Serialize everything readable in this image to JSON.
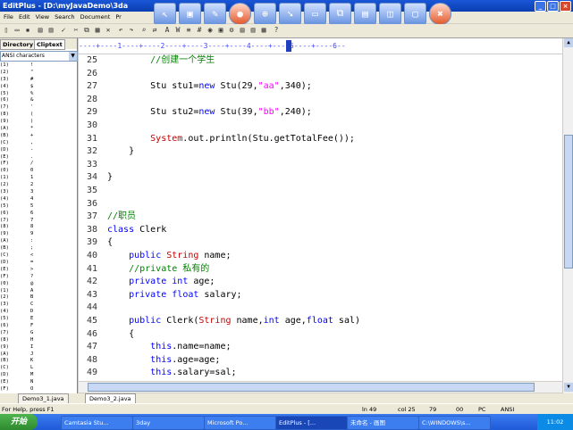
{
  "window": {
    "title": "EditPlus - [D:\\myJavaDemo\\3da"
  },
  "menu": [
    "File",
    "Edit",
    "View",
    "Search",
    "Document",
    "Pr"
  ],
  "panel": {
    "tab_directory": "Directory",
    "tab_cliptext": "Cliptext",
    "charset": "ANSI characters"
  },
  "charlist": [
    [
      "(1)",
      "!"
    ],
    [
      "(2)",
      "\""
    ],
    [
      "(3)",
      "#"
    ],
    [
      "(4)",
      "$"
    ],
    [
      "(5)",
      "%"
    ],
    [
      "(6)",
      "&"
    ],
    [
      "(7)",
      "'"
    ],
    [
      "(8)",
      "("
    ],
    [
      "(9)",
      ")"
    ],
    [
      "(A)",
      "*"
    ],
    [
      "(B)",
      "+"
    ],
    [
      "(C)",
      ","
    ],
    [
      "(D)",
      "-"
    ],
    [
      "(E)",
      "."
    ],
    [
      "(F)",
      "/"
    ],
    [
      "(0)",
      "0"
    ],
    [
      "(1)",
      "1"
    ],
    [
      "(2)",
      "2"
    ],
    [
      "(3)",
      "3"
    ],
    [
      "(4)",
      "4"
    ],
    [
      "(5)",
      "5"
    ],
    [
      "(6)",
      "6"
    ],
    [
      "(7)",
      "7"
    ],
    [
      "(8)",
      "8"
    ],
    [
      "(9)",
      "9"
    ],
    [
      "(A)",
      ":"
    ],
    [
      "(B)",
      ";"
    ],
    [
      "(C)",
      "<"
    ],
    [
      "(D)",
      "="
    ],
    [
      "(E)",
      ">"
    ],
    [
      "(F)",
      "?"
    ],
    [
      "(0)",
      "@"
    ],
    [
      "(1)",
      "A"
    ],
    [
      "(2)",
      "B"
    ],
    [
      "(3)",
      "C"
    ],
    [
      "(4)",
      "D"
    ],
    [
      "(5)",
      "E"
    ],
    [
      "(6)",
      "F"
    ],
    [
      "(7)",
      "G"
    ],
    [
      "(8)",
      "H"
    ],
    [
      "(9)",
      "I"
    ],
    [
      "(A)",
      "J"
    ],
    [
      "(B)",
      "K"
    ],
    [
      "(C)",
      "L"
    ],
    [
      "(D)",
      "M"
    ],
    [
      "(E)",
      "N"
    ],
    [
      "(F)",
      "O"
    ]
  ],
  "ruler": "----+----1----+----2----+----3----+----4----+----5----+----6--",
  "code_lines": [
    {
      "n": "25",
      "parts": [
        [
          "cm",
          "        //创建一个学生"
        ]
      ]
    },
    {
      "n": "26",
      "parts": []
    },
    {
      "n": "27",
      "parts": [
        [
          "",
          "        Stu stu1="
        ],
        [
          "kw",
          "new"
        ],
        [
          "",
          " Stu(29,"
        ],
        [
          "str",
          "\"aa\""
        ],
        [
          "",
          ",340);"
        ]
      ]
    },
    {
      "n": "28",
      "parts": []
    },
    {
      "n": "29",
      "parts": [
        [
          "",
          "        Stu stu2="
        ],
        [
          "kw",
          "new"
        ],
        [
          "",
          " Stu(39,"
        ],
        [
          "str",
          "\"bb\""
        ],
        [
          "",
          ",240);"
        ]
      ]
    },
    {
      "n": "30",
      "parts": []
    },
    {
      "n": "31",
      "parts": [
        [
          "sys",
          "        System"
        ],
        [
          "",
          ".out.println(Stu.getTotalFee());"
        ]
      ]
    },
    {
      "n": "32",
      "parts": [
        [
          "",
          "    }"
        ]
      ]
    },
    {
      "n": "33",
      "parts": []
    },
    {
      "n": "34",
      "parts": [
        [
          "",
          "}"
        ]
      ]
    },
    {
      "n": "35",
      "parts": []
    },
    {
      "n": "36",
      "parts": []
    },
    {
      "n": "37",
      "parts": [
        [
          "cm",
          "//职员"
        ]
      ]
    },
    {
      "n": "38",
      "parts": [
        [
          "kw",
          "class"
        ],
        [
          "",
          " Clerk"
        ]
      ]
    },
    {
      "n": "39",
      "parts": [
        [
          "",
          "{"
        ]
      ]
    },
    {
      "n": "40",
      "parts": [
        [
          "",
          "    "
        ],
        [
          "kw",
          "public"
        ],
        [
          "",
          " "
        ],
        [
          "ty",
          "String"
        ],
        [
          "",
          " name;"
        ]
      ]
    },
    {
      "n": "41",
      "parts": [
        [
          "cm",
          "    //private 私有的"
        ]
      ]
    },
    {
      "n": "42",
      "parts": [
        [
          "",
          "    "
        ],
        [
          "kw",
          "private"
        ],
        [
          "",
          " "
        ],
        [
          "kw",
          "int"
        ],
        [
          "",
          " age;"
        ]
      ]
    },
    {
      "n": "43",
      "parts": [
        [
          "",
          "    "
        ],
        [
          "kw",
          "private"
        ],
        [
          "",
          " "
        ],
        [
          "kw",
          "float"
        ],
        [
          "",
          " salary;"
        ]
      ]
    },
    {
      "n": "44",
      "parts": []
    },
    {
      "n": "45",
      "parts": [
        [
          "",
          "    "
        ],
        [
          "kw",
          "public"
        ],
        [
          "",
          " Clerk("
        ],
        [
          "ty",
          "String"
        ],
        [
          "",
          " name,"
        ],
        [
          "kw",
          "int"
        ],
        [
          "",
          " age,"
        ],
        [
          "kw",
          "float"
        ],
        [
          "",
          " sal)"
        ]
      ]
    },
    {
      "n": "46",
      "parts": [
        [
          "",
          "    {"
        ]
      ]
    },
    {
      "n": "47",
      "parts": [
        [
          "",
          "        "
        ],
        [
          "kw",
          "this"
        ],
        [
          "",
          ".name=name;"
        ]
      ]
    },
    {
      "n": "48",
      "parts": [
        [
          "",
          "        "
        ],
        [
          "kw",
          "this"
        ],
        [
          "",
          ".age=age;"
        ]
      ]
    },
    {
      "n": "49",
      "parts": [
        [
          "",
          "        "
        ],
        [
          "kw",
          "this"
        ],
        [
          "",
          ".salary=sal;"
        ]
      ]
    },
    {
      "n": "50",
      "parts": [
        [
          "",
          "    }"
        ]
      ]
    }
  ],
  "doc_tabs": [
    "Demo3_1.java",
    "Demo3_2.java"
  ],
  "status": {
    "help": "For Help, press F1",
    "ln": "ln 49",
    "col": "col 25",
    "num": "79",
    "zero": "00",
    "pc": "PC",
    "enc": "ANSI"
  },
  "taskbar": {
    "start": "开始",
    "items": [
      "Camtasia Stu...",
      "3day",
      "Microsoft Po...",
      "EditPlus - [...",
      "未命名 - 画图",
      "C:\\WINDOWS\\s..."
    ],
    "clock": "11:02"
  }
}
